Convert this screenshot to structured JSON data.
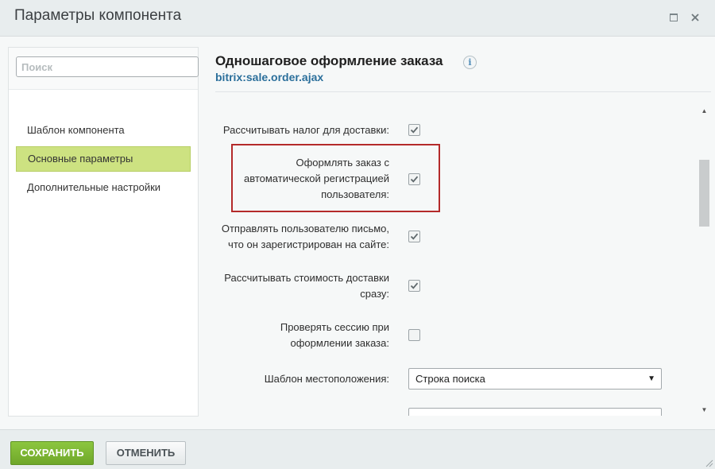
{
  "dialog": {
    "title": "Параметры компонента",
    "maximize_icon": "maximize-icon",
    "close_icon": "close-icon"
  },
  "sidebar": {
    "search_placeholder": "Поиск",
    "items": [
      {
        "label": "Шаблон компонента",
        "active": false
      },
      {
        "label": "Основные параметры",
        "active": true
      },
      {
        "label": "Дополнительные настройки",
        "active": false
      }
    ]
  },
  "main": {
    "title": "Одношаговое оформление заказа",
    "subtitle": "bitrix:sale.order.ajax",
    "info_icon": "info-icon",
    "params": [
      {
        "label": "Рассчитывать налог для доставки:",
        "checked": true
      },
      {
        "label_lines": [
          "Оформлять заказ с",
          "автоматической регистрацией",
          "пользователя:"
        ],
        "checked": true,
        "highlighted": true
      },
      {
        "label_lines": [
          "Отправлять пользователю письмо,",
          "что он зарегистрирован на сайте:"
        ],
        "checked": true
      },
      {
        "label_lines": [
          "Рассчитывать стоимость доставки",
          "сразу:"
        ],
        "checked": true
      },
      {
        "label_lines": [
          "Проверять сессию при",
          "оформлении заказа:"
        ],
        "checked": false
      },
      {
        "label": "Шаблон местоположения:",
        "select_value": "Строка поиска"
      }
    ]
  },
  "footer": {
    "save_label": "СОХРАНИТЬ",
    "cancel_label": "ОТМЕНИТЬ"
  },
  "colors": {
    "active_item": "#cde281",
    "save_button": "#7ab533",
    "highlight_border": "#b42a2a",
    "link": "#2b6f9b"
  }
}
